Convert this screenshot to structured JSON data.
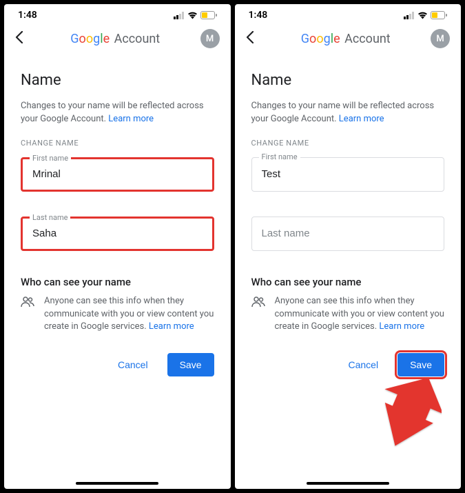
{
  "status": {
    "time": "1:48"
  },
  "header": {
    "avatar_initial": "M"
  },
  "page": {
    "title": "Name",
    "description_prefix": "Changes to your name will be reflected across your Google Account. ",
    "learn_more": "Learn more",
    "section_label": "CHANGE NAME",
    "first_name_label": "First name",
    "last_name_label": "Last name",
    "who_title": "Who can see your name",
    "who_text_prefix": "Anyone can see this info when they communicate with you or view content you create in Google services. ",
    "cancel_label": "Cancel",
    "save_label": "Save"
  },
  "left": {
    "first_name_value": "Mrinal",
    "last_name_value": "Saha"
  },
  "right": {
    "first_name_value": "Test",
    "last_name_placeholder": "Last name"
  }
}
